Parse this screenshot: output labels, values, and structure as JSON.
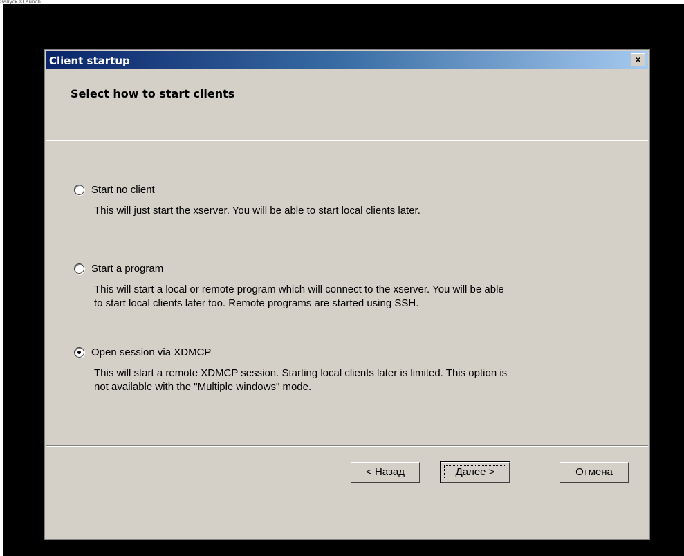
{
  "screen_caption": "Запуск XLaunch",
  "dialog": {
    "title": "Client startup",
    "close_glyph": "×",
    "heading": "Select how to start clients"
  },
  "options": [
    {
      "label": "Start no client",
      "description_lines": [
        "This will just start the xserver. You will be able to start local clients later."
      ],
      "selected": false
    },
    {
      "label": "Start a program",
      "description_lines": [
        "This will start a local or remote program which will connect to the xserver. You will be able",
        "to start local clients later too. Remote programs are started using SSH."
      ],
      "selected": false
    },
    {
      "label": "Open session via XDMCP",
      "description_lines": [
        "This will start a remote XDMCP session. Starting local clients later is limited. This option is",
        "not available with the \"Multiple windows\" mode."
      ],
      "selected": true
    }
  ],
  "buttons": {
    "back": "< Назад",
    "next": "Далее >",
    "cancel": "Отмена"
  },
  "colors": {
    "screen_background": "#000000",
    "dialog_face": "#d4d0c8",
    "titlebar_start": "#0a246a",
    "titlebar_end": "#a6caf0",
    "title_text": "#ffffff"
  }
}
